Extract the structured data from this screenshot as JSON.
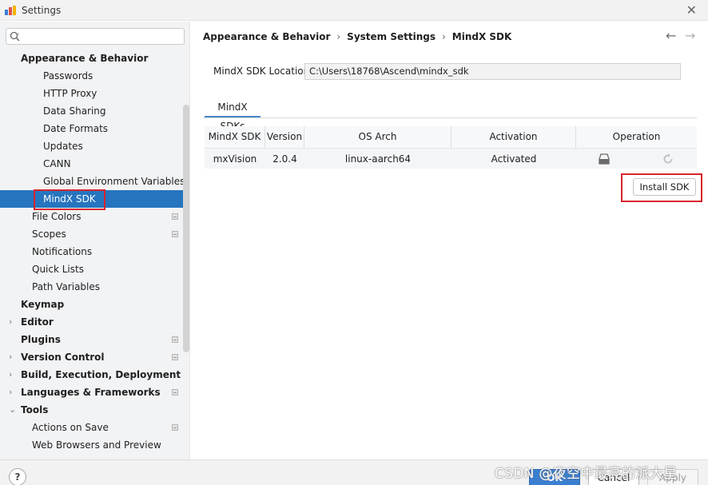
{
  "window": {
    "title": "Settings",
    "close_glyph": "✕"
  },
  "search": {
    "value": "",
    "placeholder": ""
  },
  "sidebar": {
    "items": [
      {
        "label": "Appearance & Behavior",
        "level": 0,
        "bold": true,
        "arrow": "",
        "badge": false,
        "selected": false
      },
      {
        "label": "Passwords",
        "level": 2,
        "bold": false,
        "arrow": "",
        "badge": false,
        "selected": false
      },
      {
        "label": "HTTP Proxy",
        "level": 2,
        "bold": false,
        "arrow": "",
        "badge": false,
        "selected": false
      },
      {
        "label": "Data Sharing",
        "level": 2,
        "bold": false,
        "arrow": "",
        "badge": false,
        "selected": false
      },
      {
        "label": "Date Formats",
        "level": 2,
        "bold": false,
        "arrow": "",
        "badge": false,
        "selected": false
      },
      {
        "label": "Updates",
        "level": 2,
        "bold": false,
        "arrow": "",
        "badge": false,
        "selected": false
      },
      {
        "label": "CANN",
        "level": 2,
        "bold": false,
        "arrow": "",
        "badge": false,
        "selected": false
      },
      {
        "label": "Global Environment Variables",
        "level": 2,
        "bold": false,
        "arrow": "",
        "badge": false,
        "selected": false
      },
      {
        "label": "MindX SDK",
        "level": 2,
        "bold": false,
        "arrow": "",
        "badge": false,
        "selected": true
      },
      {
        "label": "File Colors",
        "level": 1,
        "bold": false,
        "arrow": "",
        "badge": true,
        "selected": false
      },
      {
        "label": "Scopes",
        "level": 1,
        "bold": false,
        "arrow": "",
        "badge": true,
        "selected": false
      },
      {
        "label": "Notifications",
        "level": 1,
        "bold": false,
        "arrow": "",
        "badge": false,
        "selected": false
      },
      {
        "label": "Quick Lists",
        "level": 1,
        "bold": false,
        "arrow": "",
        "badge": false,
        "selected": false
      },
      {
        "label": "Path Variables",
        "level": 1,
        "bold": false,
        "arrow": "",
        "badge": false,
        "selected": false
      },
      {
        "label": "Keymap",
        "level": 0,
        "bold": true,
        "arrow": "",
        "badge": false,
        "selected": false
      },
      {
        "label": "Editor",
        "level": 0,
        "bold": true,
        "arrow": "›",
        "badge": false,
        "selected": false
      },
      {
        "label": "Plugins",
        "level": 0,
        "bold": true,
        "arrow": "",
        "badge": true,
        "selected": false
      },
      {
        "label": "Version Control",
        "level": 0,
        "bold": true,
        "arrow": "›",
        "badge": true,
        "selected": false
      },
      {
        "label": "Build, Execution, Deployment",
        "level": 0,
        "bold": true,
        "arrow": "›",
        "badge": false,
        "selected": false
      },
      {
        "label": "Languages & Frameworks",
        "level": 0,
        "bold": true,
        "arrow": "›",
        "badge": true,
        "selected": false
      },
      {
        "label": "Tools",
        "level": 0,
        "bold": true,
        "arrow": "⌄",
        "badge": false,
        "selected": false
      },
      {
        "label": "Actions on Save",
        "level": 1,
        "bold": false,
        "arrow": "",
        "badge": true,
        "selected": false
      },
      {
        "label": "Web Browsers and Preview",
        "level": 1,
        "bold": false,
        "arrow": "",
        "badge": false,
        "selected": false
      }
    ]
  },
  "breadcrumb": {
    "part1": "Appearance & Behavior",
    "part2": "System Settings",
    "part3": "MindX SDK",
    "sep": "›"
  },
  "nav": {
    "back": "←",
    "forward": "→"
  },
  "location": {
    "label": "MindX SDK Location",
    "value": "C:\\Users\\18768\\Ascend\\mindx_sdk"
  },
  "tab": {
    "label": "MindX SDKs"
  },
  "table": {
    "headers": [
      "MindX SDK",
      "Version",
      "OS Arch",
      "Activation",
      "Operation"
    ],
    "rows": [
      {
        "sdk": "mxVision",
        "version": "2.0.4",
        "arch": "linux-aarch64",
        "activation": "Activated"
      }
    ]
  },
  "install_button": {
    "label": "Install SDK"
  },
  "footer": {
    "help": "?",
    "ok": "OK",
    "cancel": "Cancel",
    "apply": "Apply"
  },
  "watermark": "CSDN @夜空中最亮的派大星",
  "colors": {
    "selected": "#2675bf",
    "highlight": "#d9232e",
    "ok": "#3b7fd0"
  }
}
